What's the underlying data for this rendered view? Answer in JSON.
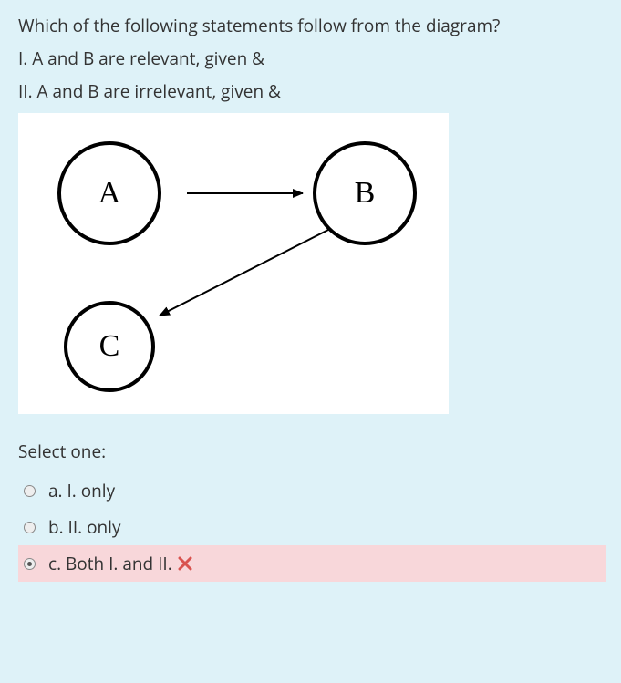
{
  "question": {
    "prompt": "Which of the following statements follow from the diagram?",
    "st1": "I. A and B are relevant, given &",
    "st2": "II. A and B are irrelevant, given &"
  },
  "diagram": {
    "nodes": {
      "A": "A",
      "B": "B",
      "C": "C"
    },
    "edges": [
      {
        "from": "A",
        "to": "B"
      },
      {
        "from": "B",
        "to": "C"
      }
    ]
  },
  "select_prompt": "Select one:",
  "options": {
    "a": "a. I. only",
    "b": "b. II. only",
    "c": "c. Both I. and II."
  },
  "selected": "c",
  "feedback": {
    "c": "incorrect"
  },
  "icons": {
    "wrong": "wrong-x"
  },
  "colors": {
    "page_bg": "#def2f8",
    "wrong_bg": "#f8d7da",
    "wrong_icon": "#d9534f"
  }
}
